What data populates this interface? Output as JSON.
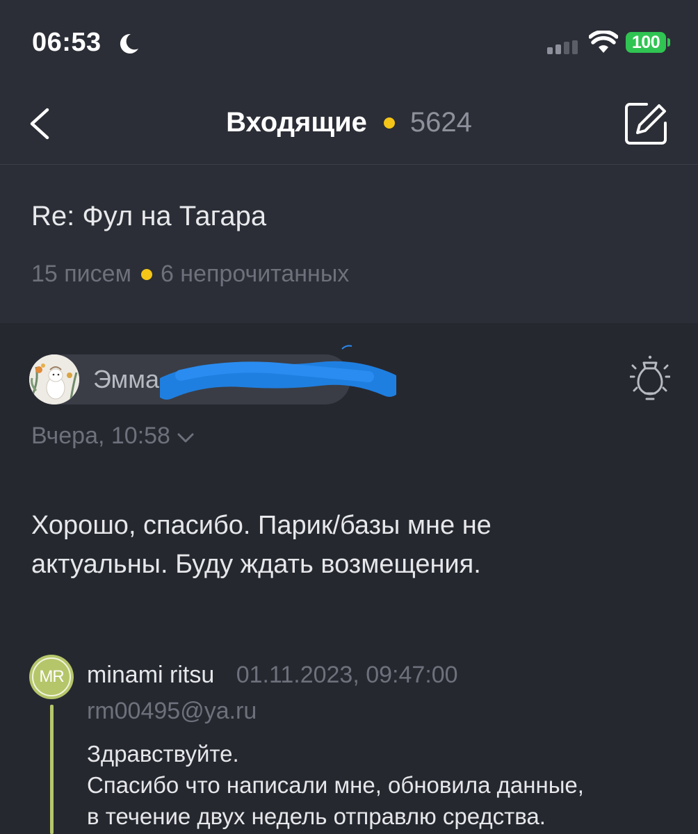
{
  "status_bar": {
    "time": "06:53",
    "battery": "100",
    "battery_color": "#30c452"
  },
  "nav": {
    "title": "Входящие",
    "unread_total": "5624",
    "accent_color": "#f5c518",
    "icons": [
      "back-arrow-icon",
      "compose-icon"
    ]
  },
  "thread": {
    "subject": "Re: Фул на Тагара",
    "count": "15 писем",
    "unread": "6 непрочитанных"
  },
  "message": {
    "sender_name": "Эмма",
    "date": "Вчера, 10:58",
    "body": [
      "Хорошо, спасибо. Парик/базы мне не",
      "актуальны. Буду ждать возмещения."
    ]
  },
  "quote": {
    "initials": "MR",
    "name": "minami ritsu",
    "date": "01.11.2023, 09:47:00",
    "email": "rm00495@ya.ru",
    "body": [
      "Здравствуйте.",
      "Спасибо что написали мне, обновила данные,",
      "в течение двух недель отправлю средства."
    ],
    "accent_color": "#b5c66a"
  }
}
